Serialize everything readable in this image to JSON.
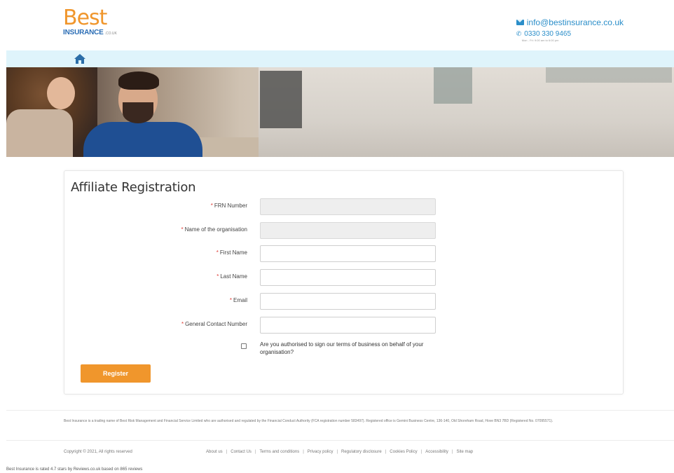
{
  "header": {
    "logo_main": "Best",
    "logo_sub": "INSURANCE",
    "logo_domain": ".CO.UK",
    "email": "info@bestinsurance.co.uk",
    "phone": "0330 330 9465",
    "hours": "Mon - Fri: 9:00 am to 6:00 pm",
    "icons": {
      "email": "envelope-icon",
      "phone": "phone-icon",
      "home": "home-icon"
    }
  },
  "colors": {
    "brand_orange": "#f0962c",
    "brand_blue": "#2b8ec9",
    "nav_bg": "#dff4fb",
    "required_red": "#e0413a"
  },
  "form": {
    "title": "Affiliate Registration",
    "fields": [
      {
        "label": "FRN Number",
        "required": true,
        "value": "",
        "disabled": true
      },
      {
        "label": "Name of the organisation",
        "required": true,
        "value": "",
        "disabled": true
      },
      {
        "label": "First Name",
        "required": true,
        "value": "",
        "disabled": false
      },
      {
        "label": "Last Name",
        "required": true,
        "value": "",
        "disabled": false
      },
      {
        "label": "Email",
        "required": true,
        "value": "",
        "disabled": false
      },
      {
        "label": "General Contact Number",
        "required": true,
        "value": "",
        "disabled": false
      }
    ],
    "required_marker": "*",
    "checkbox_label": "Are you authorised to sign our terms of business on behalf of your organisation?",
    "checkbox_checked": false,
    "submit_label": "Register"
  },
  "footer": {
    "legal": "Best Insurance is a trading name of Best Risk Management and Financial Service Limited who are authorised and regulated by the Financial Conduct Authority (FCA registration number 583497). Registered office is Gemini Business Centre, 136-140, Old Shoreham Road, Hove BN3 7BD (Registered No. 07095571).",
    "copyright": "Copyright © 2021, All rights reserved",
    "links": [
      "About us",
      "Contact Us",
      "Terms and conditions",
      "Privacy policy",
      "Regulatory disclosure",
      "Cookies Policy",
      "Accessibility",
      "Site map"
    ],
    "link_separator": "|",
    "rating": "Best Insurance is rated 4.7 stars by Reviews.co.uk based on 865 reviews"
  }
}
